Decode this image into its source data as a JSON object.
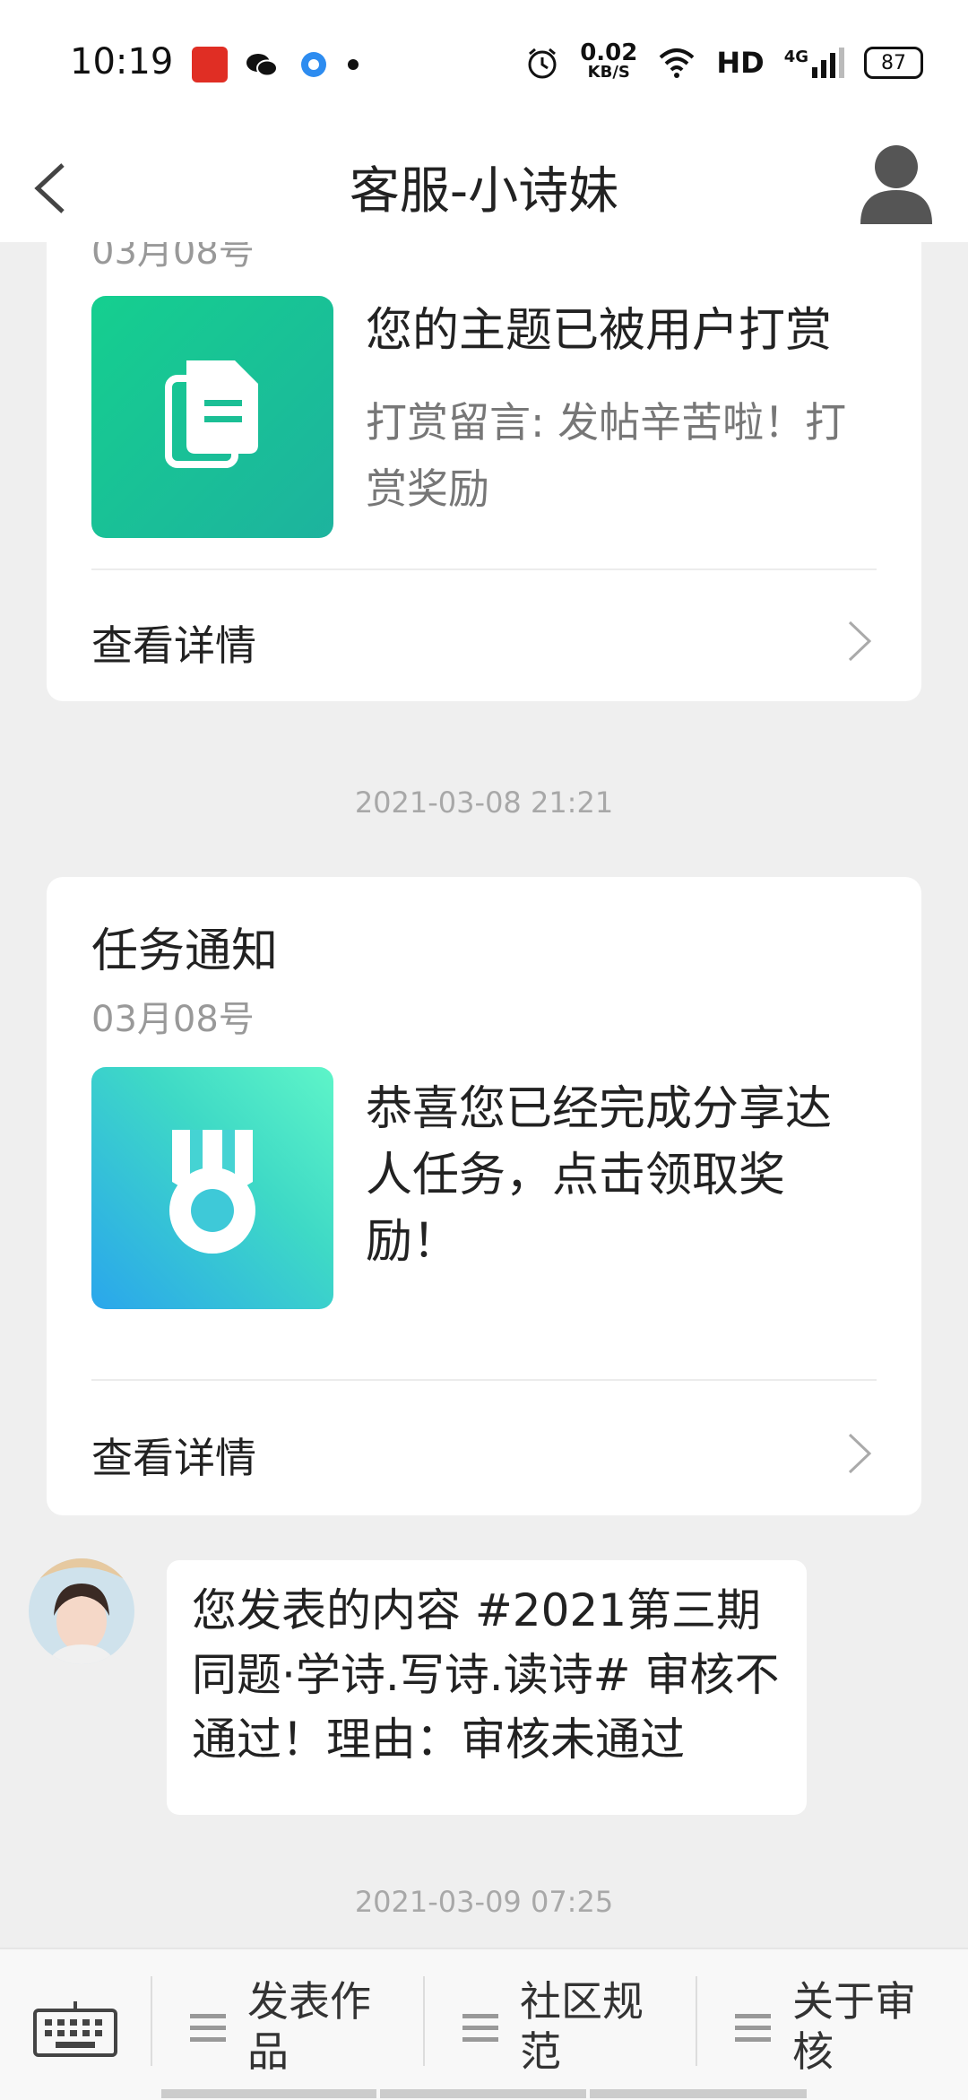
{
  "status_bar": {
    "time": "10:19",
    "network_speed": "0.02",
    "network_unit": "KB/S",
    "hd_label": "HD",
    "signal_label": "4G",
    "battery": "87"
  },
  "header": {
    "title": "客服-小诗妹"
  },
  "card1": {
    "date_partial": "03月08号",
    "title": "您的主题已被用户打赏",
    "subtitle": "打赏留言: 发帖辛苦啦！打赏奖励",
    "detail_label": "查看详情"
  },
  "timestamp1": "2021-03-08 21:21",
  "card2": {
    "title": "任务通知",
    "date": "03月08号",
    "text": "恭喜您已经完成分享达人任务，点击领取奖励！",
    "detail_label": "查看详情"
  },
  "message": {
    "text": "您发表的内容 #2021第三期同题·学诗.写诗.读诗# 审核不通过！理由：审核未通过"
  },
  "timestamp2": "2021-03-09 07:25",
  "bottom_menu": {
    "items": [
      {
        "label": "发表作品"
      },
      {
        "label": "社区规范"
      },
      {
        "label": "关于审核"
      }
    ]
  },
  "colors": {
    "accent_green": "#17c391",
    "accent_teal": "#3ed9c6",
    "accent_blue": "#2aa6ec"
  }
}
